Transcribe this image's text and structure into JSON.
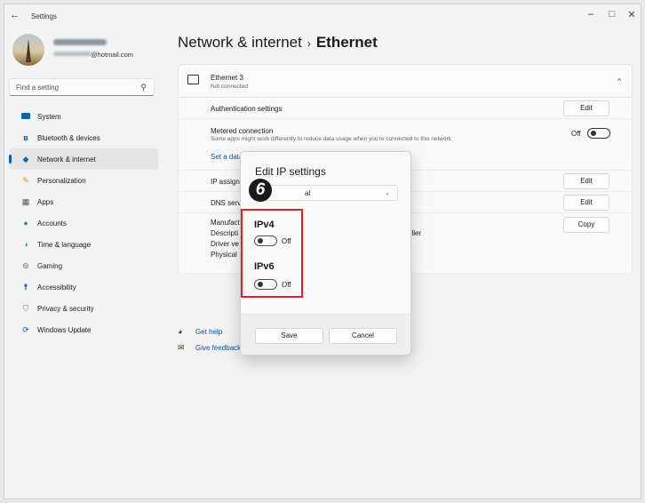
{
  "window": {
    "title": "Settings",
    "controls": {
      "minimize": "–",
      "maximize": "□",
      "close": "✕"
    }
  },
  "user": {
    "email_suffix": "@hotmail.com"
  },
  "search": {
    "placeholder": "Find a setting"
  },
  "sidebar": {
    "items": [
      {
        "label": "System",
        "icon": "monitor-icon",
        "color": "#0067c0"
      },
      {
        "label": "Bluetooth & devices",
        "icon": "bluetooth-icon",
        "color": "#0067c0"
      },
      {
        "label": "Network & internet",
        "icon": "wifi-icon",
        "color": "#0067c0",
        "active": true
      },
      {
        "label": "Personalization",
        "icon": "brush-icon",
        "color": "#d48a1c"
      },
      {
        "label": "Apps",
        "icon": "apps-icon",
        "color": "#555555"
      },
      {
        "label": "Accounts",
        "icon": "person-icon",
        "color": "#2e9b4f"
      },
      {
        "label": "Time & language",
        "icon": "globe-icon",
        "color": "#1a8fd1"
      },
      {
        "label": "Gaming",
        "icon": "gamepad-icon",
        "color": "#666666"
      },
      {
        "label": "Accessibility",
        "icon": "accessibility-icon",
        "color": "#1b5fb0"
      },
      {
        "label": "Privacy & security",
        "icon": "shield-icon",
        "color": "#777777"
      },
      {
        "label": "Windows Update",
        "icon": "update-icon",
        "color": "#0067c0"
      }
    ]
  },
  "header": {
    "crumb": "Network & internet",
    "separator": "›",
    "current": "Ethernet"
  },
  "ethernet": {
    "name": "Ethernet 3",
    "status": "Not connected",
    "auth_label": "Authentication settings",
    "edit": "Edit",
    "metered_label": "Metered connection",
    "metered_desc": "Some apps might work differently to reduce data usage when you're connected to this network",
    "metered_state": "Off",
    "data_link": "Set a data",
    "ip_label": "IP assign",
    "dns_label": "DNS serv",
    "manuf_label": "Manufact",
    "desc_label": "Descripti",
    "driver_label": "Driver ve",
    "physical_label": "Physical",
    "desc_tail": "oller",
    "copy": "Copy"
  },
  "help": {
    "get_help": "Get help",
    "give_feedback": "Give feedback"
  },
  "dialog": {
    "title": "Edit IP settings",
    "select_value": "al",
    "step_number": "6",
    "ipv4": {
      "label": "IPv4",
      "state": "Off"
    },
    "ipv6": {
      "label": "IPv6",
      "state": "Off"
    },
    "save": "Save",
    "cancel": "Cancel"
  },
  "colors": {
    "accent": "#0067c0",
    "highlight": "#d9242b"
  }
}
